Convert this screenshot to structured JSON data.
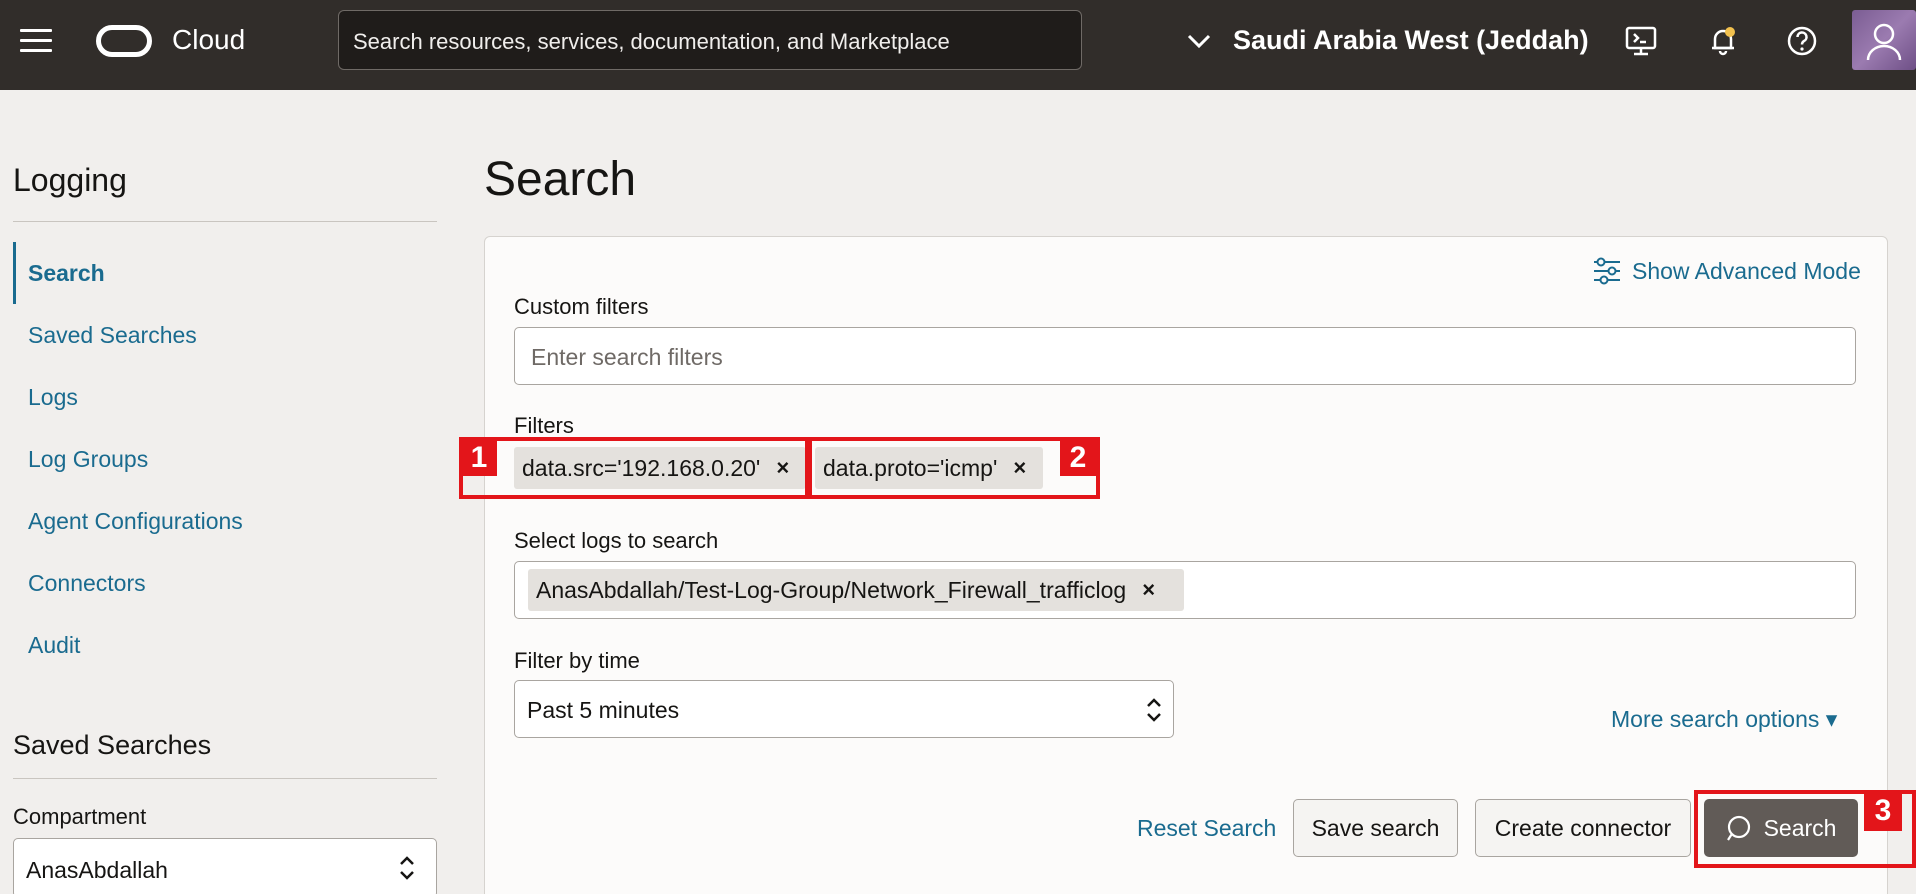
{
  "topbar": {
    "brand": "Cloud",
    "search_placeholder": "Search resources, services, documentation, and Marketplace",
    "region": "Saudi Arabia West (Jeddah)"
  },
  "sidebar": {
    "title": "Logging",
    "items": [
      {
        "label": "Search",
        "active": true
      },
      {
        "label": "Saved Searches"
      },
      {
        "label": "Logs"
      },
      {
        "label": "Log Groups"
      },
      {
        "label": "Agent Configurations"
      },
      {
        "label": "Connectors"
      },
      {
        "label": "Audit"
      }
    ],
    "saved_title": "Saved Searches",
    "compartment_label": "Compartment",
    "compartment_value": "AnasAbdallah"
  },
  "main": {
    "title": "Search",
    "advanced_mode": "Show Advanced Mode",
    "custom_filters_label": "Custom filters",
    "custom_filters_placeholder": "Enter search filters",
    "filters_label": "Filters",
    "filters": [
      "data.src='192.168.0.20'",
      "data.proto='icmp'"
    ],
    "select_logs_label": "Select logs to search",
    "selected_log": "AnasAbdallah/Test-Log-Group/Network_Firewall_trafficlog",
    "filter_time_label": "Filter by time",
    "filter_time_value": "Past 5 minutes",
    "more_options": "More search options ▾",
    "reset_label": "Reset Search",
    "save_label": "Save search",
    "connector_label": "Create connector",
    "search_label": "Search"
  },
  "annotations": [
    "1",
    "2",
    "3"
  ],
  "colors": {
    "topbar": "#312d2a",
    "link": "#1a6b8f",
    "annotation": "#e3151a",
    "primary_button": "#615b57"
  }
}
